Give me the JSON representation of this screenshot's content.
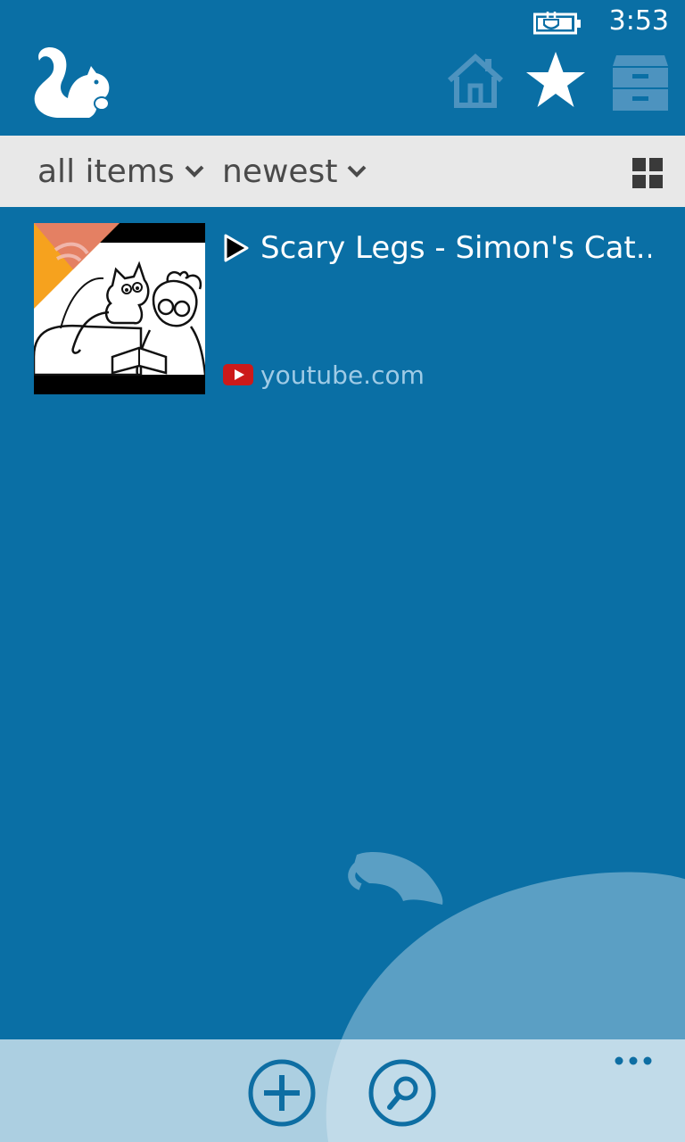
{
  "status_bar": {
    "time": "3:53",
    "battery_icon": "battery-charging-icon"
  },
  "header": {
    "logo_icon": "squirrel-icon",
    "nav": [
      {
        "icon": "home-icon"
      },
      {
        "icon": "star-icon"
      },
      {
        "icon": "archive-icon"
      }
    ]
  },
  "filters": {
    "scope_label": "all items",
    "sort_label": "newest",
    "view_toggle_icon": "grid-view-icon"
  },
  "items": [
    {
      "title": "Scary Legs - Simon's Cat...",
      "source": "youtube.com",
      "type_icon": "play-icon",
      "source_icon": "youtube-icon"
    }
  ],
  "app_bar": {
    "buttons": [
      {
        "icon": "add-icon"
      },
      {
        "icon": "search-icon"
      }
    ],
    "more_icon": "more-dots-icon"
  },
  "colors": {
    "background": "#0a6fa5",
    "filter_bar": "#e8e8e8",
    "filter_text": "#4a4a4a",
    "source_text": "#9fcbe6",
    "app_bar": "#c6dbe8",
    "app_bar_icon": "#0e6ea3"
  }
}
